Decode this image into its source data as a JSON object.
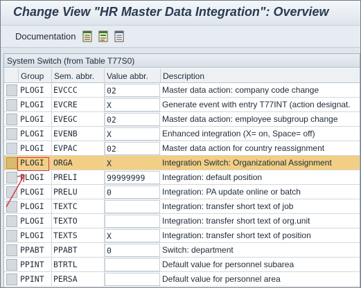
{
  "window": {
    "title": "Change View \"HR Master Data Integration\": Overview"
  },
  "toolbar": {
    "documentation_label": "Documentation",
    "icons": [
      "table-select-icon",
      "table-details-icon",
      "table-print-icon"
    ]
  },
  "panel": {
    "title": "System Switch (from Table T77S0)"
  },
  "table": {
    "columns": [
      "Group",
      "Sem. abbr.",
      "Value abbr.",
      "Description"
    ],
    "rows": [
      {
        "group": "PLOGI",
        "sem": "EVCCC",
        "value": "02",
        "desc": "Master data action: company code change"
      },
      {
        "group": "PLOGI",
        "sem": "EVCRE",
        "value": "X",
        "desc": "Generate event with entry T77INT (action designat."
      },
      {
        "group": "PLOGI",
        "sem": "EVEGC",
        "value": "02",
        "desc": "Master data action: employee subgroup change"
      },
      {
        "group": "PLOGI",
        "sem": "EVENB",
        "value": "X",
        "desc": "Enhanced integration (X= on, Space= off)"
      },
      {
        "group": "PLOGI",
        "sem": "EVPAC",
        "value": "02",
        "desc": "Master data action for country reassignment"
      },
      {
        "group": "PLOGI",
        "sem": "ORGA",
        "value": "X",
        "desc": "Integration Switch: Organizational Assignment"
      },
      {
        "group": "PLOGI",
        "sem": "PRELI",
        "value": "99999999",
        "desc": "Integration: default position"
      },
      {
        "group": "PLOGI",
        "sem": "PRELU",
        "value": "0",
        "desc": "Integration: PA update online or batch"
      },
      {
        "group": "PLOGI",
        "sem": "TEXTC",
        "value": "",
        "desc": "Integration: transfer short text of job"
      },
      {
        "group": "PLOGI",
        "sem": "TEXTO",
        "value": "",
        "desc": "Integration: transfer short text of org.unit"
      },
      {
        "group": "PLOGI",
        "sem": "TEXTS",
        "value": "X",
        "desc": "Integration: transfer short text of position"
      },
      {
        "group": "PPABT",
        "sem": "PPABT",
        "value": "0",
        "desc": "Switch: department"
      },
      {
        "group": "PPINT",
        "sem": "BTRTL",
        "value": "",
        "desc": "Default value for personnel subarea"
      },
      {
        "group": "PPINT",
        "sem": "PERSA",
        "value": "",
        "desc": "Default value for personnel area"
      }
    ],
    "selected_row": 5
  },
  "colors": {
    "selected_row": "#f2cf84",
    "annotation": "#d63b3b",
    "title_text": "#2a3a52"
  }
}
